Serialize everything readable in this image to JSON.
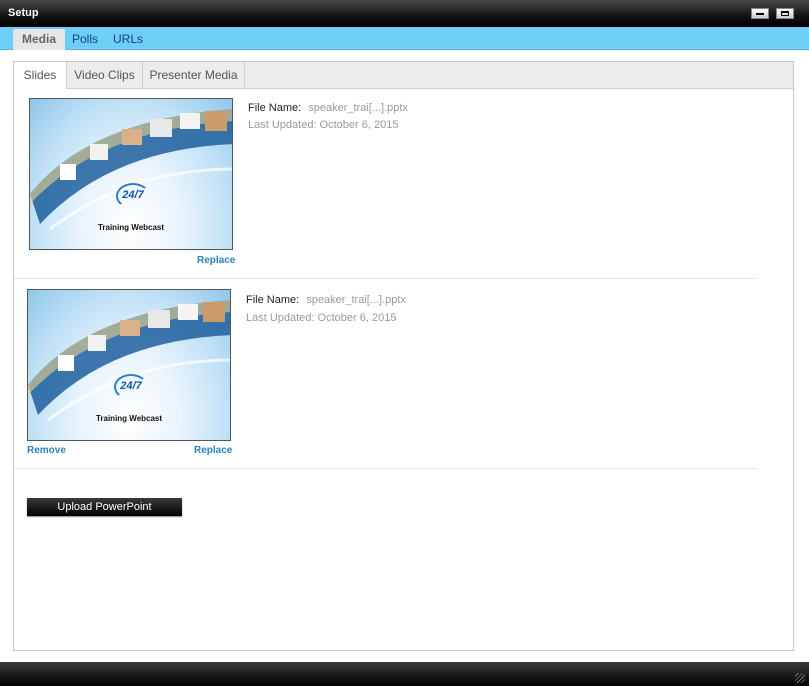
{
  "window": {
    "title": "Setup"
  },
  "main_tabs": [
    {
      "label": "Media",
      "active": true
    },
    {
      "label": "Polls",
      "active": false
    },
    {
      "label": "URLs",
      "active": false
    }
  ],
  "sub_tabs": [
    {
      "label": "Slides",
      "active": true
    },
    {
      "label": "Video Clips",
      "active": false
    },
    {
      "label": "Presenter Media",
      "active": false
    }
  ],
  "slides": [
    {
      "thumb_brand": "24/7",
      "thumb_caption": "Training Webcast",
      "file_name_label": "File Name:",
      "file_name": "speaker_trai[...].pptx",
      "last_updated": "Last Updated: October 6, 2015",
      "replace_label": "Replace"
    },
    {
      "thumb_brand": "24/7",
      "thumb_caption": "Training Webcast",
      "file_name_label": "File Name:",
      "file_name": "speaker_trai[...].pptx",
      "last_updated": "Last Updated: October 6, 2015",
      "remove_label": "Remove",
      "replace_label": "Replace"
    }
  ],
  "upload_button": {
    "label": "Upload PowerPoint"
  }
}
